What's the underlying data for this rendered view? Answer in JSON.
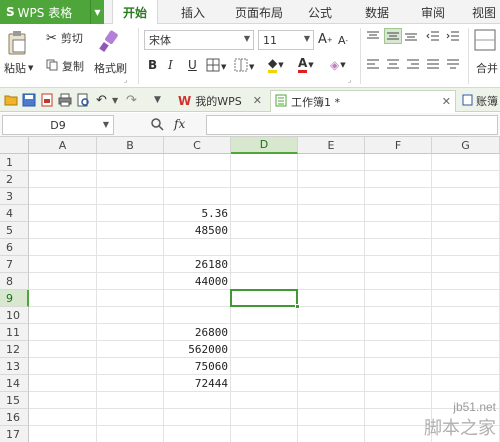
{
  "app": {
    "name": "WPS 表格",
    "logo_glyph": "S"
  },
  "menu": {
    "tabs": [
      "开始",
      "插入",
      "页面布局",
      "公式",
      "数据",
      "审阅",
      "视图"
    ],
    "active_index": 0
  },
  "ribbon": {
    "paste_label": "粘贴",
    "cut_label": "剪切",
    "copy_label": "复制",
    "format_painter_label": "格式刷",
    "font_name": "宋体",
    "font_size": "11",
    "increase_font": "A",
    "decrease_font": "A",
    "bold": "B",
    "italic": "I",
    "underline": "U",
    "merge_label": "合并"
  },
  "doc_tabs": {
    "tab1": "我的WPS",
    "tab2": "工作簿1 *",
    "tab3": "账簿"
  },
  "formula_bar": {
    "cell_ref": "D9",
    "fx": "fx",
    "value": ""
  },
  "sheet": {
    "columns": [
      "A",
      "B",
      "C",
      "D",
      "E",
      "F",
      "G"
    ],
    "rows": [
      "1",
      "2",
      "3",
      "4",
      "5",
      "6",
      "7",
      "8",
      "9",
      "10",
      "11",
      "12",
      "13",
      "14",
      "15",
      "16",
      "17"
    ],
    "selected_column": "D",
    "selected_row": "9",
    "values": {
      "c4": "5.36",
      "c5": "48500",
      "c7": "26180",
      "c8": "44000",
      "c11": "26800",
      "c12": "562000",
      "c13": "75060",
      "c14": "72444"
    }
  },
  "colors": {
    "accent": "#4ea63a",
    "selection": "#3f9a33"
  },
  "watermark": {
    "line1": "jb51.net",
    "line2": "脚本之家"
  }
}
